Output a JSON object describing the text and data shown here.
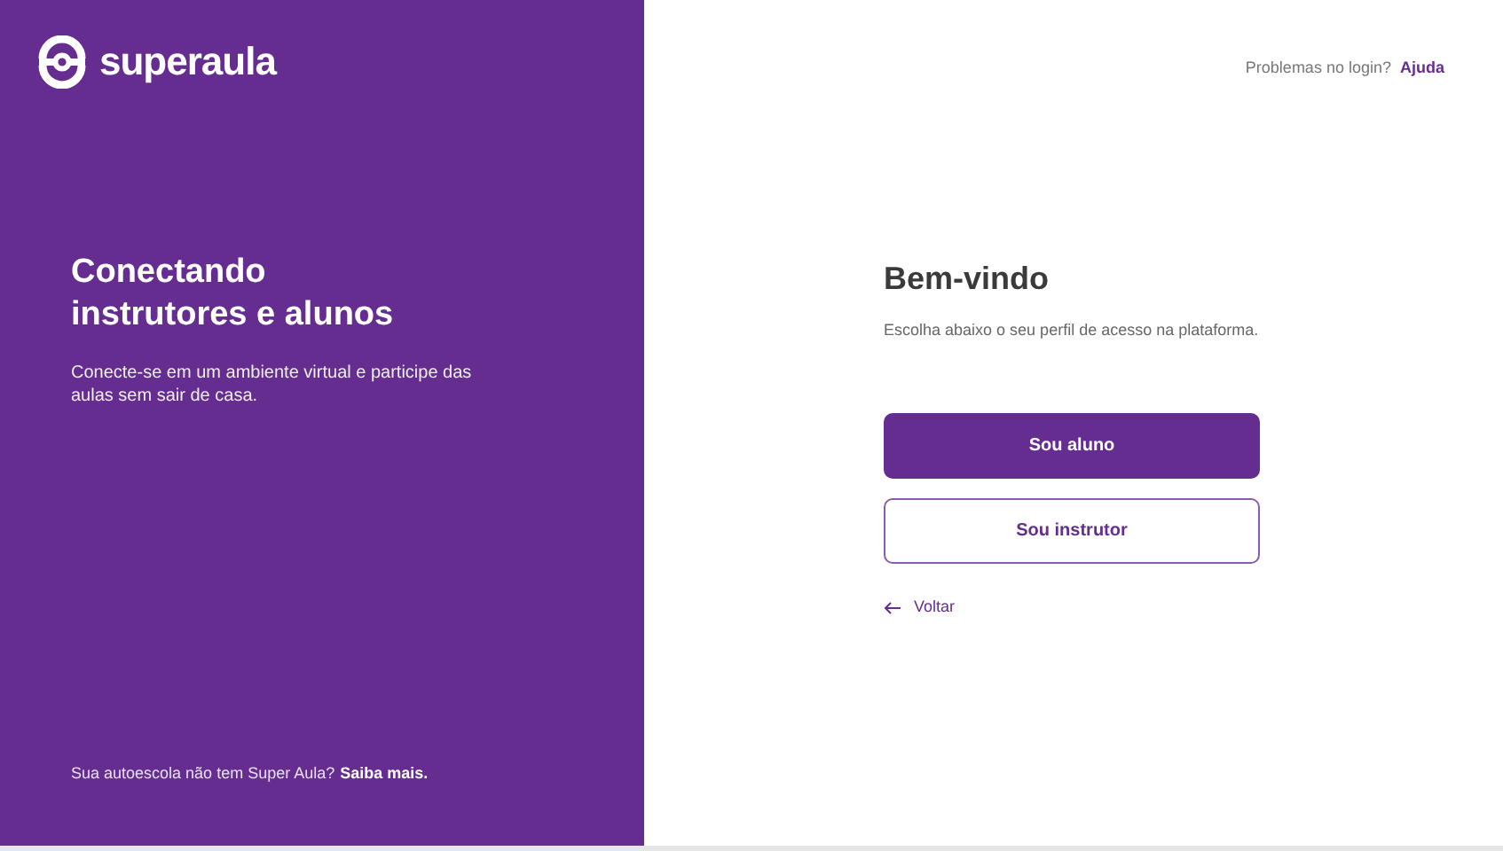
{
  "brand": {
    "name": "superaula"
  },
  "hero": {
    "title_lines": [
      "Conectando",
      "instrutores e alunos"
    ],
    "subtitle": "Conecte-se em um ambiente virtual e participe das aulas sem sair de casa.",
    "footer_text": "Sua autoescola não tem Super Aula?",
    "footer_link": "Saiba mais."
  },
  "help": {
    "text": "Problemas no login?",
    "link": "Ajuda"
  },
  "welcome": {
    "title": "Bem-vindo",
    "subtitle": "Escolha abaixo o seu perfil de acesso na plataforma."
  },
  "buttons": [
    {
      "label": "Sou aluno",
      "kind": "primary"
    },
    {
      "label": "Sou instrutor",
      "kind": "outline"
    }
  ],
  "back": {
    "label": "Voltar"
  }
}
